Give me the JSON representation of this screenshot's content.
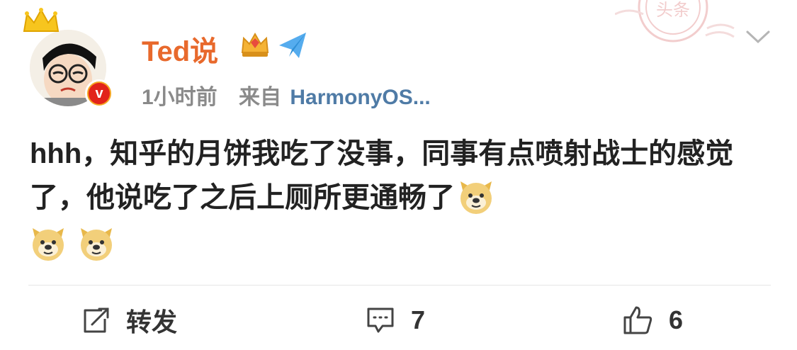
{
  "post": {
    "author": {
      "name": "Ted说"
    },
    "meta": {
      "time": "1小时前",
      "source_prefix": "来自",
      "source_name": "HarmonyOS..."
    },
    "stamp_text": "头条",
    "content_text": "hhh，知乎的月饼我吃了没事，同事有点喷射战士的感觉了，他说吃了之后上厕所更通畅了",
    "emoji_count": 3
  },
  "actions": {
    "repost_label": "转发",
    "comment_count": "7",
    "like_count": "6"
  },
  "colors": {
    "username": "#e8692c",
    "source_link": "#4f7ba6",
    "meta_gray": "#8a8a8a",
    "text": "#222222",
    "verified_badge": "#e2231a"
  },
  "icons": [
    "crown-icon",
    "vip-crown-icon",
    "paper-plane-icon",
    "stamp-icon",
    "chevron-down-icon",
    "doge-emoji-icon",
    "repost-icon",
    "comment-icon",
    "like-icon"
  ]
}
